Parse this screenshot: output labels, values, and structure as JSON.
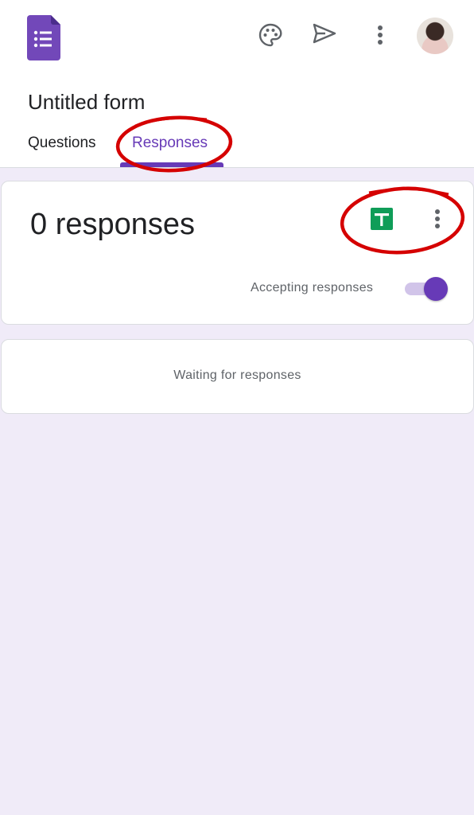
{
  "app": {
    "logo_icon": "google-forms-icon",
    "palette_icon": "palette-icon",
    "send_icon": "send-icon",
    "more_icon": "more-vert-icon",
    "avatar": "user-avatar"
  },
  "form": {
    "title": "Untitled form"
  },
  "tabs": [
    {
      "label": "Questions",
      "active": false
    },
    {
      "label": "Responses",
      "active": true
    }
  ],
  "summary": {
    "count_text": "0 responses",
    "sheets_icon": "google-sheets-icon",
    "more_icon": "more-vert-icon",
    "accepting_label": "Accepting responses",
    "accepting": true
  },
  "waiting": {
    "text": "Waiting for responses"
  },
  "colors": {
    "accent": "#673ab7",
    "background": "#f0ebf8",
    "sheets_green": "#0f9d58",
    "annotation_red": "#d50000"
  }
}
